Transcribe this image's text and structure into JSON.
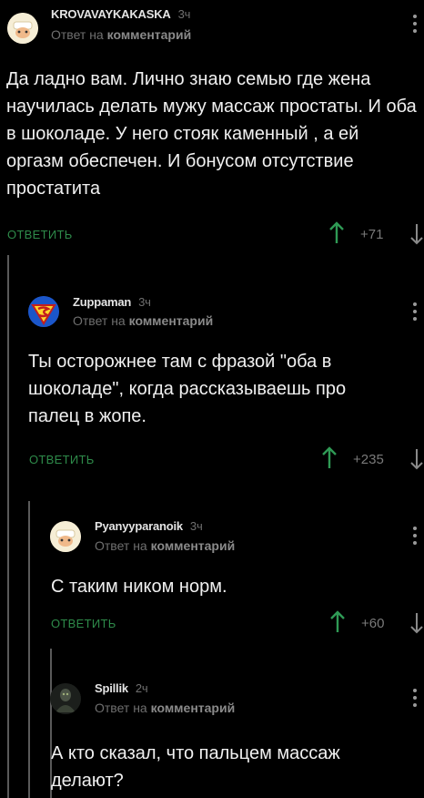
{
  "comments": [
    {
      "username": "KROVAVAYKAKASKA",
      "time": "3ч",
      "reply_prefix": "Ответ на",
      "reply_target": "комментарий",
      "text": "Да ладно вам. Лично знаю семью где жена научилась делать мужу массаж простаты. И оба в шоколаде. У него стояк каменный , а ей оргазм обеспечен. И бонусом отсутствие простатита",
      "reply_label": "ОТВЕТИТЬ",
      "score": "+71"
    },
    {
      "username": "Zuppaman",
      "time": "3ч",
      "reply_prefix": "Ответ на",
      "reply_target": "комментарий",
      "text": "Ты осторожнее там с фразой \"оба в шоколаде\", когда рассказываешь про палец в жопе.",
      "reply_label": "ОТВЕТИТЬ",
      "score": "+235"
    },
    {
      "username": "Pyanyyparanoik",
      "time": "3ч",
      "reply_prefix": "Ответ на",
      "reply_target": "комментарий",
      "text": "С таким ником норм.",
      "reply_label": "ОТВЕТИТЬ",
      "score": "+60"
    },
    {
      "username": "Spillik",
      "time": "2ч",
      "reply_prefix": "Ответ на",
      "reply_target": "комментарий",
      "text": "А кто сказал, что пальцем массаж делают?"
    }
  ],
  "colors": {
    "background": "#000000",
    "reply_green": "#2e8b4a",
    "vote_up": "#2f9a55",
    "muted": "#6f6f6f"
  },
  "icons": {
    "upvote": "arrow-up-icon",
    "downvote": "arrow-down-icon",
    "menu": "vertical-dots-icon"
  }
}
